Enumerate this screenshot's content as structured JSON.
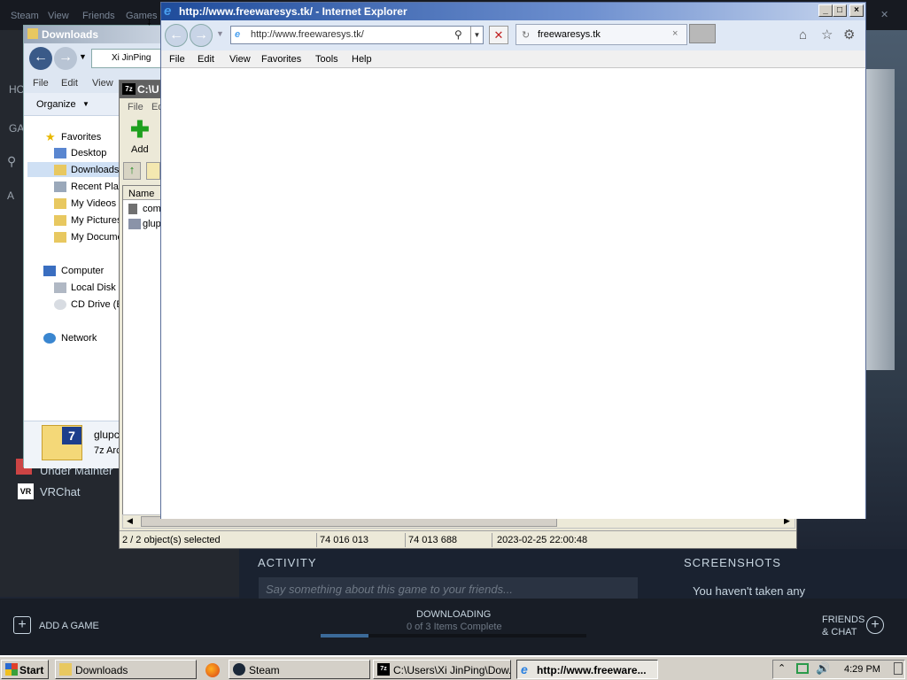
{
  "steam": {
    "menu": [
      "Steam",
      "View",
      "Friends",
      "Games"
    ],
    "close_glyph": "✕",
    "nav_home": "HO",
    "nav_games": "GA",
    "nav_all": "A",
    "games": [
      "Under Mainter",
      "VRChat"
    ],
    "vr_badge": "VR",
    "activity_label": "ACTIVITY",
    "screenshots_label": "SCREENSHOTS",
    "say_placeholder": "Say something about this game to your friends...",
    "no_screenshots": "You haven't taken any",
    "add_game": "ADD A GAME",
    "downloading": "DOWNLOADING",
    "download_status": "0 of 3 Items Complete",
    "download_progress": 0.18,
    "friends_chat_1": "FRIENDS",
    "friends_chat_2": "& CHAT"
  },
  "explorer": {
    "title": "Downloads",
    "breadcrumb": "Xi JinPing",
    "menu": [
      "File",
      "Edit",
      "View"
    ],
    "organize": "Organize",
    "favorites": "Favorites",
    "tree": [
      "Desktop",
      "Downloads",
      "Recent Plac",
      "My Videos",
      "My Pictures",
      "My Docume"
    ],
    "computer": "Computer",
    "drives": [
      "Local Disk (",
      "CD Drive (E"
    ],
    "network": "Network",
    "detail_name": "glupc",
    "detail_type": "7z Arc",
    "sevenz_badge": "7"
  },
  "sevenzip": {
    "title": "C:\\U",
    "menu": [
      "File",
      "Ed"
    ],
    "add_label": "Add",
    "col_name": "Name",
    "files": [
      "com",
      "glup"
    ],
    "status_selected": "2 / 2 object(s) selected",
    "status_size": "74 016 013",
    "status_packed": "74 013 688",
    "status_date": "2023-02-25 22:00:48"
  },
  "ie": {
    "title": "http://www.freewaresys.tk/ - Internet Explorer",
    "address": "http://www.freewaresys.tk/",
    "tab_label": "freewaresys.tk",
    "menu": [
      "File",
      "Edit",
      "View",
      "Favorites",
      "Tools",
      "Help"
    ]
  },
  "taskbar": {
    "start": "Start",
    "items": [
      "Downloads",
      "Steam",
      "C:\\Users\\Xi JinPing\\Dow...",
      "http://www.freeware..."
    ],
    "clock": "4:29 PM"
  }
}
